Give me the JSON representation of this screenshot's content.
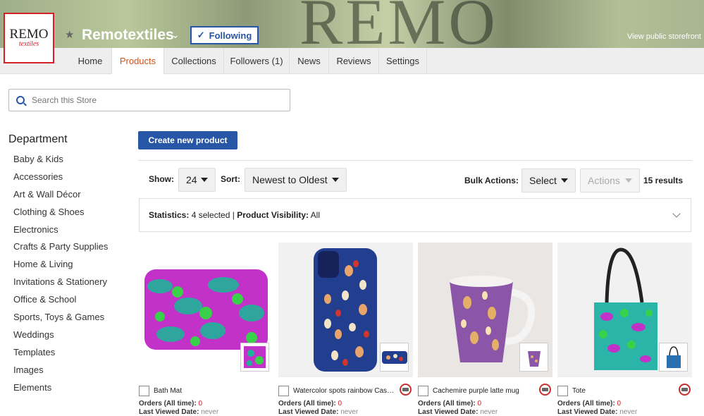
{
  "banner": {
    "text": "REMO"
  },
  "logo": {
    "top": "REMO",
    "bottom": "textiles"
  },
  "store": {
    "name": "Remotextiles",
    "follow_label": "Following",
    "view_public": "View public storefront"
  },
  "tabs": [
    {
      "label": "Home"
    },
    {
      "label": "Products"
    },
    {
      "label": "Collections"
    },
    {
      "label": "Followers (1)"
    },
    {
      "label": "News"
    },
    {
      "label": "Reviews"
    },
    {
      "label": "Settings"
    }
  ],
  "search": {
    "placeholder": "Search this Store"
  },
  "sidebar": {
    "title": "Department",
    "items": [
      "Baby & Kids",
      "Accessories",
      "Art & Wall Décor",
      "Clothing & Shoes",
      "Electronics",
      "Crafts & Party Supplies",
      "Home & Living",
      "Invitations & Stationery",
      "Office & School",
      "Sports, Toys & Games",
      "Weddings",
      "Templates",
      "Images",
      "Elements"
    ]
  },
  "toolbar": {
    "create_label": "Create new product",
    "show_label": "Show:",
    "show_value": "24",
    "sort_label": "Sort:",
    "sort_value": "Newest to Oldest",
    "bulk_label": "Bulk Actions:",
    "bulk_value": "Select",
    "actions_value": "Actions",
    "results": "15 results"
  },
  "stats": {
    "stats_label": "Statistics:",
    "stats_value": " 4 selected | ",
    "vis_label": "Product Visibility:",
    "vis_value": " All"
  },
  "products": [
    {
      "name": "Bath Mat",
      "orders_label": "Orders (All time):",
      "orders": "0",
      "viewed_label": "Last Viewed Date:",
      "viewed": "never",
      "has_badge": false
    },
    {
      "name": "Watercolor spots rainbow Case-Mate iPhone Case",
      "orders_label": "Orders (All time):",
      "orders": "0",
      "viewed_label": "Last Viewed Date:",
      "viewed": "never",
      "has_badge": true
    },
    {
      "name": "Cachemire purple latte mug",
      "orders_label": "Orders (All time):",
      "orders": "0",
      "viewed_label": "Last Viewed Date:",
      "viewed": "never",
      "has_badge": true
    },
    {
      "name": "Tote",
      "orders_label": "Orders (All time):",
      "orders": "0",
      "viewed_label": "Last Viewed Date:",
      "viewed": "never",
      "has_badge": true
    }
  ]
}
